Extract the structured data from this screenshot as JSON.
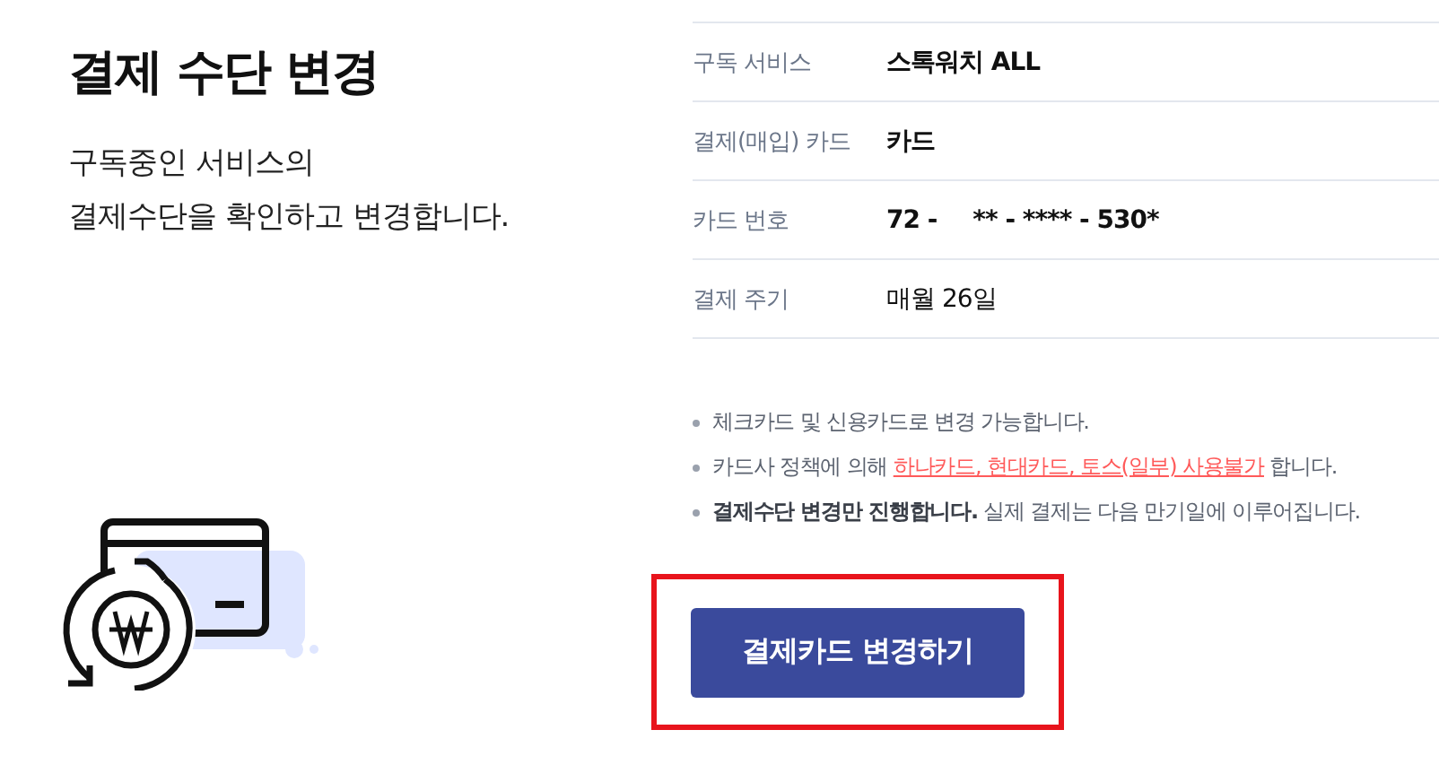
{
  "title": "결제 수단 변경",
  "subtitle": [
    "구독중인 서비스의",
    "결제수단을 확인하고 변경합니다."
  ],
  "details": [
    {
      "label": "구독 서비스",
      "parts": [
        "스톡워치 ALL"
      ],
      "bold": true
    },
    {
      "label": "결제(매입) 카드",
      "parts": [
        "카드"
      ],
      "bold": true
    },
    {
      "label": "카드 번호",
      "parts": [
        "72 -",
        "** - **** - 530*"
      ],
      "bold": true
    },
    {
      "label": "결제 주기",
      "parts": [
        "매월 26일"
      ],
      "bold": false
    }
  ],
  "notes": [
    {
      "text": "체크카드 및 신용카드로 변경 가능합니다."
    },
    {
      "text": "카드사 정책에 의해",
      "link": "하나카드, 현대카드, 토스(일부) 사용불가",
      "after": "합니다."
    },
    {
      "text": "**결제수단 변경만 진행합니다.** 실제 결제는 다음 만기일에 이루어집니다."
    }
  ],
  "button": "결제카드 변경하기"
}
